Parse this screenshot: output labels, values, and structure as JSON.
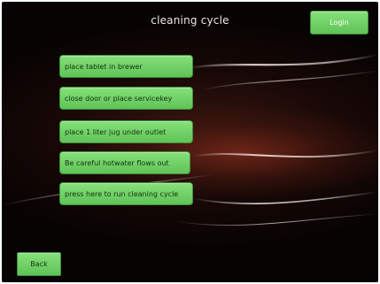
{
  "screen": {
    "title": "cleaning cycle"
  },
  "header": {
    "login_label": "Login"
  },
  "steps": [
    {
      "label": "place tablet in brewer"
    },
    {
      "label": "close door or place servicekey"
    },
    {
      "label": "place 1 liter jug under outlet"
    },
    {
      "label": "Be careful hotwater flows out"
    },
    {
      "label": "press here to run cleaning cycle"
    }
  ],
  "footer": {
    "back_label": "Back"
  },
  "colors": {
    "button_green": "#6fd066",
    "background_dark": "#070303",
    "background_glow": "#7a2819"
  }
}
